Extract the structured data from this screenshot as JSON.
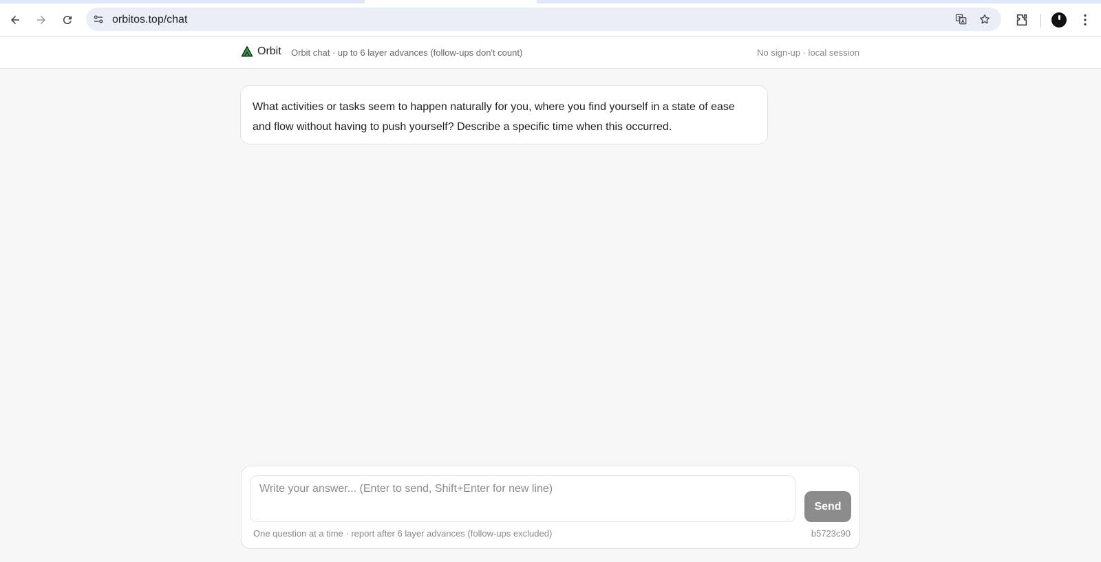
{
  "browser": {
    "url": "orbitos.top/chat"
  },
  "header": {
    "brand": "Orbit",
    "subtitle": "Orbit chat · up to 6 layer advances (follow-ups don't count)",
    "session": "No sign-up · local session",
    "brand_color": "#2e9e3a"
  },
  "chat": {
    "messages": [
      {
        "role": "assistant",
        "text": "What activities or tasks seem to happen naturally for you, where you find yourself in a state of ease and flow without having to push yourself? Describe a specific time when this occurred."
      }
    ]
  },
  "composer": {
    "placeholder": "Write your answer... (Enter to send, Shift+Enter for new line)",
    "value": "",
    "send_label": "Send",
    "hint": "One question at a time · report after 6 layer advances (follow-ups excluded)",
    "build": "b5723c90"
  }
}
